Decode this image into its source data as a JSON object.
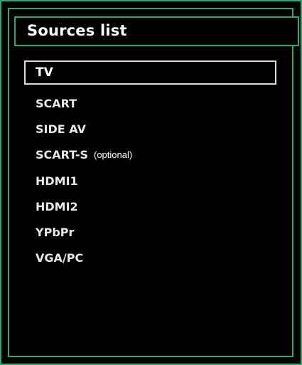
{
  "colors": {
    "background": "#000000",
    "frame_green": "#2fa86b",
    "text": "#ffffff",
    "selection_border": "#dddddd"
  },
  "title": "Sources list",
  "items": [
    {
      "label": "TV",
      "selected": true
    },
    {
      "label": "SCART"
    },
    {
      "label": "SIDE AV"
    },
    {
      "label": "SCART-S",
      "note": "(optional)"
    },
    {
      "label": "HDMI1"
    },
    {
      "label": "HDMI2"
    },
    {
      "label": "YPbPr"
    },
    {
      "label": "VGA/PC"
    }
  ]
}
